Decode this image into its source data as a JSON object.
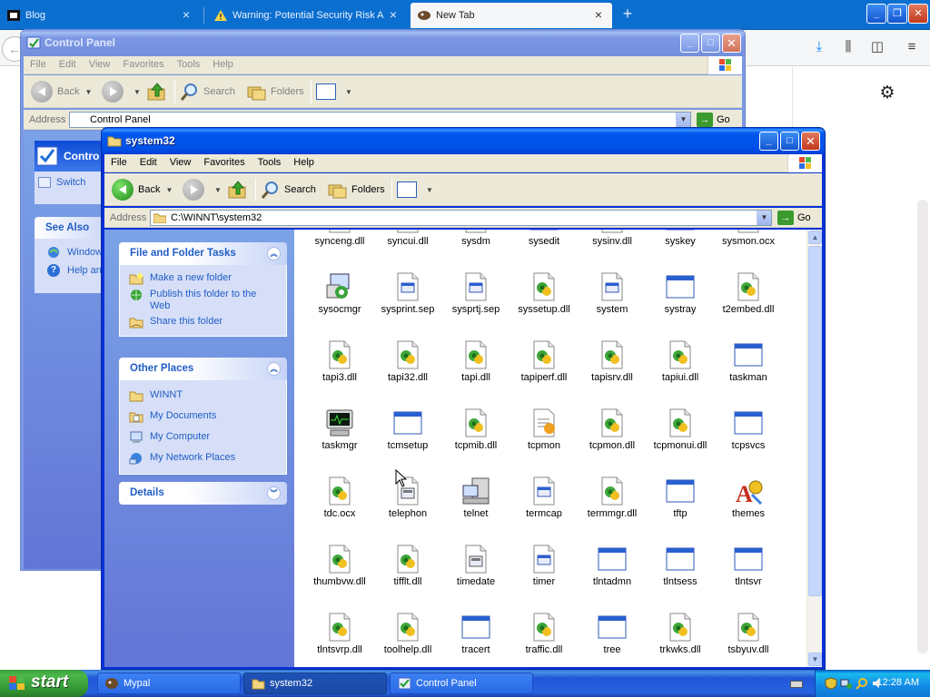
{
  "browser": {
    "tabs": [
      {
        "label": "Blog"
      },
      {
        "label": "Warning: Potential Security Risk A"
      },
      {
        "label": "New Tab"
      }
    ],
    "new_tab_symbol": "+",
    "window_buttons": {
      "minimize": "_",
      "maximize": "❐",
      "close": "✕"
    }
  },
  "control_panel": {
    "title": "Control Panel",
    "menu": [
      "File",
      "Edit",
      "View",
      "Favorites",
      "Tools",
      "Help"
    ],
    "toolbar": {
      "back": "Back",
      "search": "Search",
      "folders": "Folders",
      "go": "Go"
    },
    "address_label": "Address",
    "address_value": "Control Panel",
    "pane_heading": "Contro",
    "switch_label": "Switch",
    "see_also_heading": "See Also",
    "see_also_items": [
      "Window",
      "Help an"
    ]
  },
  "system32": {
    "title": "system32",
    "menu": [
      "File",
      "Edit",
      "View",
      "Favorites",
      "Tools",
      "Help"
    ],
    "toolbar": {
      "back": "Back",
      "search": "Search",
      "folders": "Folders",
      "go": "Go"
    },
    "address_label": "Address",
    "address_value": "C:\\WINNT\\system32",
    "tasks": {
      "file_folder": {
        "heading": "File and Folder Tasks",
        "items": [
          "Make a new folder",
          "Publish this folder to the Web",
          "Share this folder"
        ]
      },
      "other_places": {
        "heading": "Other Places",
        "items": [
          "WINNT",
          "My Documents",
          "My Computer",
          "My Network Places"
        ]
      },
      "details": {
        "heading": "Details"
      }
    },
    "files": [
      {
        "name": "synceng.dll",
        "type": "dll"
      },
      {
        "name": "syncui.dll",
        "type": "dll"
      },
      {
        "name": "sysdm",
        "type": "cpl"
      },
      {
        "name": "sysedit",
        "type": "exe"
      },
      {
        "name": "sysinv.dll",
        "type": "dll"
      },
      {
        "name": "syskey",
        "type": "exe"
      },
      {
        "name": "sysmon.ocx",
        "type": "dll"
      },
      {
        "name": "sysocmgr",
        "type": "setup"
      },
      {
        "name": "sysprint.sep",
        "type": "sep"
      },
      {
        "name": "sysprtj.sep",
        "type": "sep"
      },
      {
        "name": "syssetup.dll",
        "type": "dll"
      },
      {
        "name": "system",
        "type": "sep"
      },
      {
        "name": "systray",
        "type": "exe"
      },
      {
        "name": "t2embed.dll",
        "type": "dll"
      },
      {
        "name": "tapi3.dll",
        "type": "dll"
      },
      {
        "name": "tapi32.dll",
        "type": "dll"
      },
      {
        "name": "tapi.dll",
        "type": "dll"
      },
      {
        "name": "tapiperf.dll",
        "type": "dll"
      },
      {
        "name": "tapisrv.dll",
        "type": "dll"
      },
      {
        "name": "tapiui.dll",
        "type": "dll"
      },
      {
        "name": "taskman",
        "type": "exe"
      },
      {
        "name": "taskmgr",
        "type": "monitor"
      },
      {
        "name": "tcmsetup",
        "type": "exe"
      },
      {
        "name": "tcpmib.dll",
        "type": "dll"
      },
      {
        "name": "tcpmon",
        "type": "ini"
      },
      {
        "name": "tcpmon.dll",
        "type": "dll"
      },
      {
        "name": "tcpmonui.dll",
        "type": "dll"
      },
      {
        "name": "tcpsvcs",
        "type": "exe"
      },
      {
        "name": "tdc.ocx",
        "type": "dll"
      },
      {
        "name": "telephon",
        "type": "cpl"
      },
      {
        "name": "telnet",
        "type": "telnet"
      },
      {
        "name": "termcap",
        "type": "sep"
      },
      {
        "name": "termmgr.dll",
        "type": "dll"
      },
      {
        "name": "tftp",
        "type": "exe"
      },
      {
        "name": "themes",
        "type": "themes"
      },
      {
        "name": "thumbvw.dll",
        "type": "dll"
      },
      {
        "name": "tifflt.dll",
        "type": "dll"
      },
      {
        "name": "timedate",
        "type": "cpl"
      },
      {
        "name": "timer",
        "type": "sep"
      },
      {
        "name": "tlntadmn",
        "type": "exe"
      },
      {
        "name": "tlntsess",
        "type": "exe"
      },
      {
        "name": "tlntsvr",
        "type": "exe"
      },
      {
        "name": "tlntsvrp.dll",
        "type": "dll"
      },
      {
        "name": "toolhelp.dll",
        "type": "dll"
      },
      {
        "name": "tracert",
        "type": "exe"
      },
      {
        "name": "traffic.dll",
        "type": "dll"
      },
      {
        "name": "tree",
        "type": "exe"
      },
      {
        "name": "trkwks.dll",
        "type": "dll"
      },
      {
        "name": "tsbyuv.dll",
        "type": "dll"
      }
    ]
  },
  "taskbar": {
    "start_label": "start",
    "tasks": [
      {
        "label": "Mypal"
      },
      {
        "label": "system32"
      },
      {
        "label": "Control Panel"
      }
    ],
    "clock": "12:28 AM"
  },
  "colors": {
    "xp_title_blue": "#0058ee",
    "taskpane_link": "#215dc6",
    "browser_tabbar": "#0b6fd0",
    "start_green": "#3c9a3c"
  }
}
